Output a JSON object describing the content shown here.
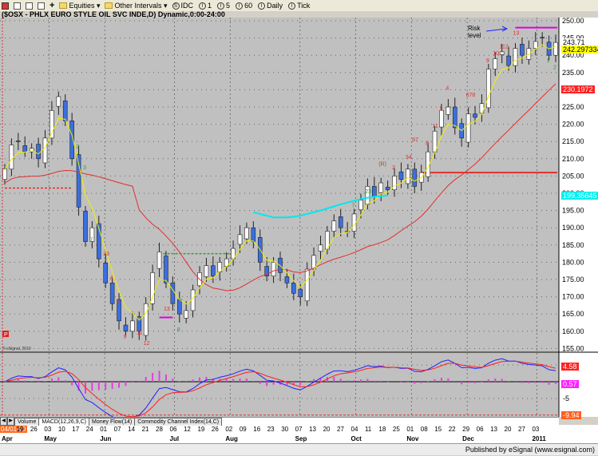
{
  "toolbar": {
    "items": [
      {
        "icon": "chart-style-icon"
      },
      {
        "icon": "layout-icon"
      },
      {
        "icon": "layout2-icon"
      },
      {
        "icon": "properties-icon"
      },
      {
        "icon": "plus-icon"
      }
    ],
    "plus": "+",
    "equities": "Equities ▾",
    "other_intervals": "Other Intervals ▾",
    "intervals": [
      {
        "badge": "S",
        "label": "IDC"
      },
      {
        "badge": "I",
        "label": "1"
      },
      {
        "badge": "I",
        "label": "5"
      },
      {
        "badge": "I",
        "label": "60"
      },
      {
        "badge": "I",
        "label": "Daily"
      },
      {
        "badge": "I",
        "label": "Tick"
      }
    ]
  },
  "chart_title": "($OSX - PHLX EURO STYLE OIL SVC INDE,D) Dynamic,0:00-24:00",
  "tabs": [
    "Volume",
    "MACD(12,26,9,C)",
    "Money Flow(14)",
    "Commodity Channel Index(14,C)"
  ],
  "footer": "Published by eSignal (www.esignal.com)",
  "copyright": "© eSignal, 2010",
  "p_marker": "P",
  "annotation": {
    "line1": "Risk",
    "line2": "level"
  },
  "colors": {
    "up": "#ffffff",
    "down": "#3a6fe0",
    "ema_short": "#f0f000",
    "ma_mid": "#e03030",
    "ma_long": "#00e8f0",
    "macd": "#2020ff",
    "signal": "#ff2020",
    "hist": "#e040e0",
    "risk": "#e000e0"
  },
  "chart_data": {
    "type": "candlestick",
    "title": "$OSX - PHLX EURO STYLE OIL SVC INDE, Daily",
    "ylim": [
      155,
      250
    ],
    "yticks": [
      "250.00",
      "245.00",
      "240.00",
      "235.00",
      "230.00",
      "225.00",
      "220.00",
      "215.00",
      "210.00",
      "205.00",
      "200.00",
      "195.00",
      "190.00",
      "185.00",
      "180.00",
      "175.00",
      "170.00",
      "165.00",
      "160.00",
      "155.00"
    ],
    "closes": [
      207,
      214,
      215,
      212,
      213,
      210,
      216,
      224,
      228,
      221,
      210,
      196,
      186,
      190,
      181,
      174,
      168,
      163,
      160,
      163,
      160,
      168,
      177,
      183,
      174,
      168,
      165,
      166,
      172,
      177,
      179,
      176,
      180,
      181,
      184,
      188,
      190,
      186,
      180,
      176,
      180,
      177,
      174,
      171,
      170,
      178,
      182,
      185,
      189,
      192,
      190,
      189,
      194,
      198,
      202,
      199,
      203,
      201,
      205,
      204,
      207,
      202,
      206,
      212,
      218,
      224,
      225,
      219,
      216,
      223,
      222,
      226,
      236,
      239,
      241,
      237,
      242,
      240,
      242,
      244,
      245,
      240,
      243.71
    ],
    "ma_long": {
      "start": 37,
      "values": [
        194.5,
        194,
        193.5,
        193,
        193,
        193,
        193.2,
        193.5,
        194,
        194.5,
        195,
        195.6,
        196.2,
        196.8,
        197.3,
        197.8,
        198.3,
        198.7,
        199.0,
        199.2,
        199.35645
      ]
    },
    "levels": [
      {
        "price": 201.5,
        "from": 0,
        "to": 10,
        "style": "dash",
        "color": "#e03030"
      },
      {
        "price": 182.5,
        "from": 23,
        "to": 34,
        "style": "dash",
        "color": "#30a030"
      },
      {
        "price": 206,
        "from": 62,
        "to": 82,
        "style": "solid",
        "color": "#e03030"
      },
      {
        "price": 248,
        "from": 76,
        "to": 82,
        "style": "solid",
        "color": "#e000e0"
      },
      {
        "price": 164,
        "from": 23,
        "to": 25,
        "style": "solid",
        "color": "#e000e0"
      }
    ],
    "last_values": [
      {
        "text": "243.71",
        "bg": "#ffffff",
        "fg": "#000000",
        "price": 243.71
      },
      {
        "text": "242.297334",
        "bg": "#ffff00",
        "fg": "#000000",
        "price": 241.6
      },
      {
        "text": "230.1972",
        "bg": "#ff2020",
        "fg": "#ffffff",
        "price": 230.1972
      },
      {
        "text": "199.35645",
        "bg": "#00f0f0",
        "fg": "#ffffff",
        "price": 199.35645
      }
    ],
    "td_counts": [
      {
        "i": 10,
        "p": 218,
        "t": "1",
        "c": "#30a030"
      },
      {
        "i": 11,
        "p": 213,
        "t": "2",
        "c": "#30a030"
      },
      {
        "i": 12,
        "p": 207,
        "t": "3",
        "c": "#30a030"
      },
      {
        "i": 13,
        "p": 186,
        "t": "7",
        "c": "#30a030"
      },
      {
        "i": 15,
        "p": 182,
        "t": "23",
        "c": "#e03030"
      },
      {
        "i": 16,
        "p": 175,
        "t": "4",
        "c": "#e03030"
      },
      {
        "i": 17,
        "p": 168,
        "t": "6",
        "c": "#e03030"
      },
      {
        "i": 18,
        "p": 158,
        "t": "9",
        "c": "#e03030"
      },
      {
        "i": 20,
        "p": 159,
        "t": "11",
        "c": "#e03030"
      },
      {
        "i": 21,
        "p": 156,
        "t": "12",
        "c": "#e03030"
      },
      {
        "i": 24,
        "p": 166,
        "t": "13",
        "c": "#e03030"
      },
      {
        "i": 26,
        "p": 160,
        "t": "8",
        "c": "#30a030"
      },
      {
        "i": 52,
        "p": 196,
        "t": "7",
        "c": "#30a030"
      },
      {
        "i": 54,
        "p": 200,
        "t": "23",
        "c": "#30a030"
      },
      {
        "i": 56,
        "p": 208,
        "t": "(R)",
        "c": "#a05020"
      },
      {
        "i": 58,
        "p": 207,
        "t": "2",
        "c": "#e03030"
      },
      {
        "i": 60,
        "p": 210,
        "t": "34",
        "c": "#e03030"
      },
      {
        "i": 61,
        "p": 215,
        "t": "67",
        "c": "#e03030"
      },
      {
        "i": 63,
        "p": 214,
        "t": "8",
        "c": "#e03030"
      },
      {
        "i": 64,
        "p": 219,
        "t": "11",
        "c": "#e03030"
      },
      {
        "i": 65,
        "p": 224,
        "t": "1",
        "c": "#e03030"
      },
      {
        "i": 66,
        "p": 230,
        "t": "4",
        "c": "#e03030"
      },
      {
        "i": 69,
        "p": 228,
        "t": "678",
        "c": "#e03030"
      },
      {
        "i": 72,
        "p": 238,
        "t": "9",
        "c": "#e03030"
      },
      {
        "i": 73,
        "p": 240,
        "t": "10",
        "c": "#e03030"
      },
      {
        "i": 74,
        "p": 242,
        "t": "112",
        "c": "#e03030"
      },
      {
        "i": 76,
        "p": 246,
        "t": "13",
        "c": "#e03030"
      },
      {
        "i": 81,
        "p": 238,
        "t": "1",
        "c": "#30a030"
      },
      {
        "i": 82,
        "p": 236,
        "t": "2",
        "c": "#30a030"
      }
    ],
    "macd_labels": [
      {
        "text": "4.58",
        "bg": "#ff2020",
        "fg": "#ffffff",
        "value": 4.58
      },
      {
        "text": "0.57",
        "bg": "#ff20ff",
        "fg": "#ffffff",
        "value": -0.6
      },
      {
        "text": "-5",
        "bg": "",
        "fg": "#000000",
        "value": -5
      },
      {
        "text": "-9.94",
        "bg": "#ff6020",
        "fg": "#ffffff",
        "value": -9.94
      }
    ],
    "date_labels": [
      "04/01/10",
      "19",
      "26",
      "03",
      "10",
      "17",
      "24",
      "01",
      "07",
      "14",
      "21",
      "28",
      "06",
      "12",
      "19",
      "26",
      "02",
      "09",
      "16",
      "23",
      "30",
      "07",
      "13",
      "20",
      "27",
      "04",
      "11",
      "18",
      "25",
      "01",
      "08",
      "15",
      "22",
      "29",
      "06",
      "13",
      "20",
      "27",
      "03"
    ],
    "months": [
      {
        "label": "Apr",
        "at": -1
      },
      {
        "label": "May",
        "at": 3
      },
      {
        "label": "Jun",
        "at": 7
      },
      {
        "label": "Jul",
        "at": 12
      },
      {
        "label": "Aug",
        "at": 16
      },
      {
        "label": "Sep",
        "at": 21
      },
      {
        "label": "Oct",
        "at": 25
      },
      {
        "label": "Nov",
        "at": 29
      },
      {
        "label": "Dec",
        "at": 33
      },
      {
        "label": "2011",
        "at": 38
      }
    ]
  }
}
